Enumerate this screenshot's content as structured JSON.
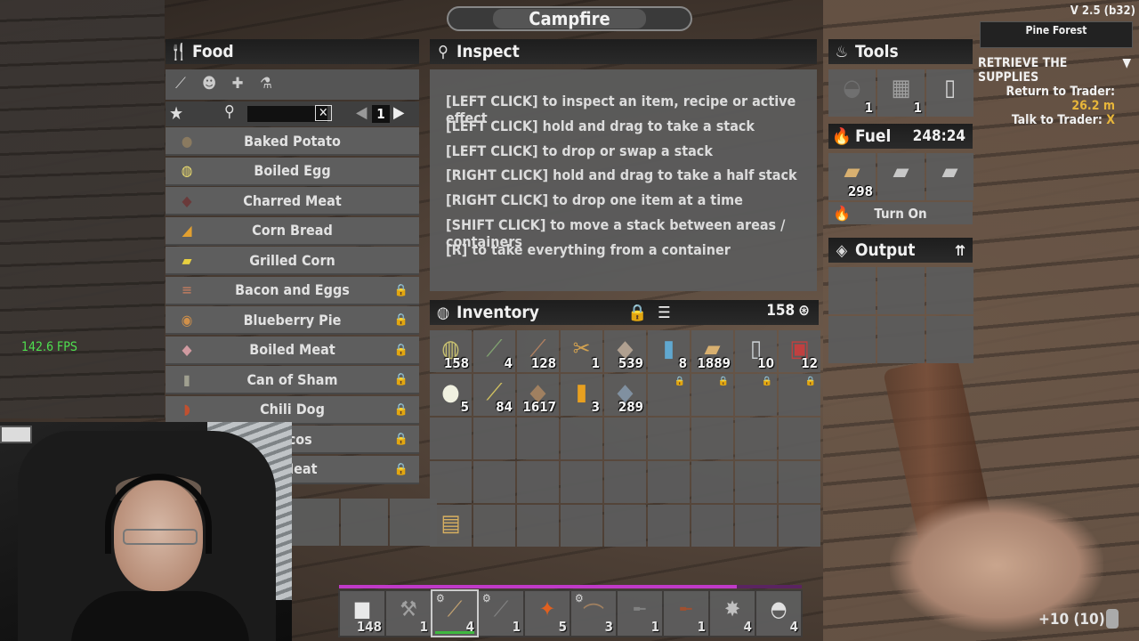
{
  "window": {
    "title": "Campfire",
    "version": "V 2.5 (b32)"
  },
  "hud": {
    "biome": "Pine Forest",
    "quest": {
      "title": "RETRIEVE THE SUPPLIES",
      "line1_label": "Return to Trader:",
      "line1_value": "26.2 m",
      "line2_label": "Talk to Trader:",
      "line2_value": "X"
    },
    "fps": "142.6 FPS"
  },
  "food": {
    "title": "Food",
    "tab_icons": [
      "fork-icon",
      "head-icon",
      "medkit-icon",
      "chemistry-icon"
    ],
    "search_placeholder": "",
    "page": "1",
    "recipes": [
      {
        "name": "Baked Potato",
        "icon": "●",
        "color": "#8a7a60",
        "locked": false
      },
      {
        "name": "Boiled Egg",
        "icon": "◍",
        "color": "#f0e070",
        "locked": false
      },
      {
        "name": "Charred Meat",
        "icon": "◆",
        "color": "#6a3a3a",
        "locked": false
      },
      {
        "name": "Corn Bread",
        "icon": "◢",
        "color": "#e2a030",
        "locked": false
      },
      {
        "name": "Grilled Corn",
        "icon": "▰",
        "color": "#e8d040",
        "locked": false
      },
      {
        "name": "Bacon and Eggs",
        "icon": "≡",
        "color": "#d08060",
        "locked": true
      },
      {
        "name": "Blueberry Pie",
        "icon": "◉",
        "color": "#d0904a",
        "locked": true
      },
      {
        "name": "Boiled Meat",
        "icon": "◆",
        "color": "#d09aa0",
        "locked": true
      },
      {
        "name": "Can of Sham",
        "icon": "▮",
        "color": "#a0a090",
        "locked": true
      },
      {
        "name": "Chili Dog",
        "icon": "◗",
        "color": "#c05030",
        "locked": true
      },
      {
        "name": "Tacos",
        "icon": "◗",
        "color": "#d0a040",
        "locked": true
      },
      {
        "name": "d Meat",
        "icon": "◆",
        "color": "#a06050",
        "locked": true
      }
    ]
  },
  "inspect": {
    "title": "Inspect",
    "lines": [
      "[LEFT CLICK] to inspect an item, recipe or active effect",
      "[LEFT CLICK] hold and drag to take a stack",
      "[LEFT CLICK] to drop or swap a stack",
      "[RIGHT CLICK] hold and drag to take a half stack",
      "[RIGHT CLICK] to drop one item at a time",
      "[SHIFT CLICK] to move a stack between areas / containers",
      "[R] to take everything from a container"
    ]
  },
  "inventory": {
    "title": "Inventory",
    "currency": "158",
    "slots": [
      {
        "icon": "◍",
        "color": "#c8c070",
        "count": "158"
      },
      {
        "icon": "⟋",
        "color": "#80a070",
        "count": "4"
      },
      {
        "icon": "⟋",
        "color": "#b08060",
        "count": "128"
      },
      {
        "icon": "✂",
        "color": "#d0a050",
        "count": "1"
      },
      {
        "icon": "◆",
        "color": "#b0a090",
        "count": "539"
      },
      {
        "icon": "▮",
        "color": "#60a8d0",
        "count": "8"
      },
      {
        "icon": "▰",
        "color": "#d8b070",
        "count": "1889"
      },
      {
        "icon": "▯",
        "color": "#cfd4d8",
        "count": "10"
      },
      {
        "icon": "▣",
        "color": "#c04040",
        "count": "12"
      },
      {
        "icon": "●",
        "color": "#f0f0e0",
        "count": "5"
      },
      {
        "icon": "⟋",
        "color": "#d0c060",
        "count": "84"
      },
      {
        "icon": "◆",
        "color": "#a08060",
        "count": "1617"
      },
      {
        "icon": "▮",
        "color": "#e8a020",
        "count": "3"
      },
      {
        "icon": "◆",
        "color": "#8090a0",
        "count": "289"
      },
      {
        "icon": "",
        "color": "#888",
        "count": "",
        "lock": true
      },
      {
        "icon": "",
        "color": "#888",
        "count": "",
        "lock": true
      },
      {
        "icon": "",
        "color": "#888",
        "count": "",
        "lock": true
      },
      {
        "icon": "",
        "color": "#888",
        "count": "",
        "lock": true
      },
      {
        "icon": "",
        "color": "#888",
        "count": ""
      },
      {
        "icon": "",
        "color": "#888",
        "count": ""
      },
      {
        "icon": "",
        "color": "#888",
        "count": ""
      },
      {
        "icon": "",
        "color": "#888",
        "count": ""
      },
      {
        "icon": "",
        "color": "#888",
        "count": ""
      },
      {
        "icon": "",
        "color": "#888",
        "count": ""
      },
      {
        "icon": "",
        "color": "#888",
        "count": ""
      },
      {
        "icon": "",
        "color": "#888",
        "count": ""
      },
      {
        "icon": "",
        "color": "#888",
        "count": ""
      },
      {
        "icon": "",
        "color": "#888",
        "count": ""
      },
      {
        "icon": "",
        "color": "#888",
        "count": ""
      },
      {
        "icon": "",
        "color": "#888",
        "count": ""
      },
      {
        "icon": "",
        "color": "#888",
        "count": ""
      },
      {
        "icon": "",
        "color": "#888",
        "count": ""
      },
      {
        "icon": "",
        "color": "#888",
        "count": ""
      },
      {
        "icon": "",
        "color": "#888",
        "count": ""
      },
      {
        "icon": "",
        "color": "#888",
        "count": ""
      },
      {
        "icon": "",
        "color": "#888",
        "count": ""
      },
      {
        "icon": "▤",
        "color": "#d8b060",
        "count": ""
      },
      {
        "icon": "",
        "color": "#888",
        "count": ""
      },
      {
        "icon": "",
        "color": "#888",
        "count": ""
      },
      {
        "icon": "",
        "color": "#888",
        "count": ""
      },
      {
        "icon": "",
        "color": "#888",
        "count": ""
      },
      {
        "icon": "",
        "color": "#888",
        "count": ""
      },
      {
        "icon": "",
        "color": "#888",
        "count": ""
      },
      {
        "icon": "",
        "color": "#888",
        "count": ""
      },
      {
        "icon": "",
        "color": "#888",
        "count": ""
      }
    ]
  },
  "tools": {
    "title": "Tools",
    "slots": [
      {
        "icon": "◒",
        "color": "#707070",
        "count": "1"
      },
      {
        "icon": "▦",
        "color": "#a0a0a0",
        "count": "1"
      },
      {
        "icon": "▯",
        "color": "#d8d8d8",
        "count": ""
      }
    ]
  },
  "fuel": {
    "title": "Fuel",
    "time": "248:24",
    "slots": [
      {
        "icon": "▰",
        "color": "#d8b070",
        "count": "298"
      },
      {
        "icon": "▰",
        "color": "#c8c8c8",
        "count": ""
      },
      {
        "icon": "▰",
        "color": "#c8c8c8",
        "count": ""
      }
    ],
    "turn_on_label": "Turn On"
  },
  "output": {
    "title": "Output",
    "slots": 6
  },
  "left_extra_slots": 3,
  "hotbar": {
    "progress": 0.86,
    "slots": [
      {
        "icon": "■",
        "color": "#e8e8e8",
        "count": "148"
      },
      {
        "icon": "⚒",
        "color": "#a0a0a0",
        "count": "1"
      },
      {
        "icon": "⟋",
        "color": "#c0a070",
        "count": "4",
        "selected": true,
        "gear": true,
        "bar": true
      },
      {
        "icon": "⟋",
        "color": "#808080",
        "count": "1",
        "gear": true
      },
      {
        "icon": "✦",
        "color": "#e06020",
        "count": "5"
      },
      {
        "icon": "⌒",
        "color": "#a08060",
        "count": "3",
        "gear": true
      },
      {
        "icon": "╾",
        "color": "#808080",
        "count": "1"
      },
      {
        "icon": "╾",
        "color": "#a05030",
        "count": "1"
      },
      {
        "icon": "✸",
        "color": "#c0c0c0",
        "count": "4"
      },
      {
        "icon": "◓",
        "color": "#e0e0e0",
        "count": "4"
      }
    ],
    "ammo": "+10 (10)"
  }
}
